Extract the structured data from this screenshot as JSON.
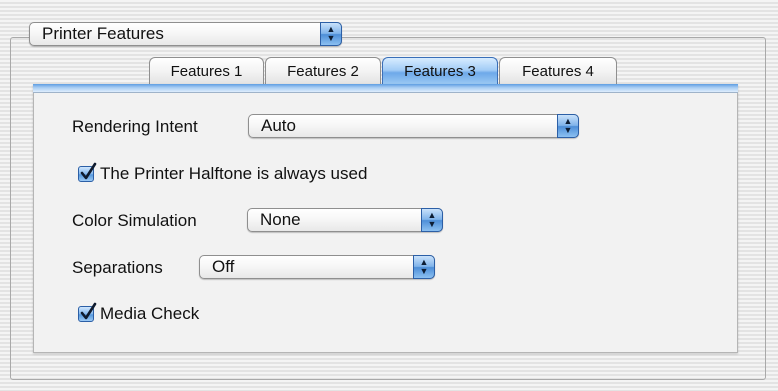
{
  "printer_menu": {
    "value": "Printer Features"
  },
  "tabs": [
    {
      "label": "Features 1",
      "active": false
    },
    {
      "label": "Features 2",
      "active": false
    },
    {
      "label": "Features 3",
      "active": true
    },
    {
      "label": "Features 4",
      "active": false
    }
  ],
  "rendering_intent": {
    "label": "Rendering Intent",
    "value": "Auto"
  },
  "halftone": {
    "label": "The Printer Halftone is always used",
    "checked": true
  },
  "color_simulation": {
    "label": "Color Simulation",
    "value": "None"
  },
  "separations": {
    "label": "Separations",
    "value": "Off"
  },
  "media_check": {
    "label": "Media Check",
    "checked": true
  },
  "colors": {
    "accent": "#6ea9e9",
    "accent_dark": "#2c5fa6",
    "panel": "#f2f2f2"
  },
  "icons": {
    "popup_arrows": "up-down-arrows-icon",
    "check": "checkmark-icon"
  }
}
